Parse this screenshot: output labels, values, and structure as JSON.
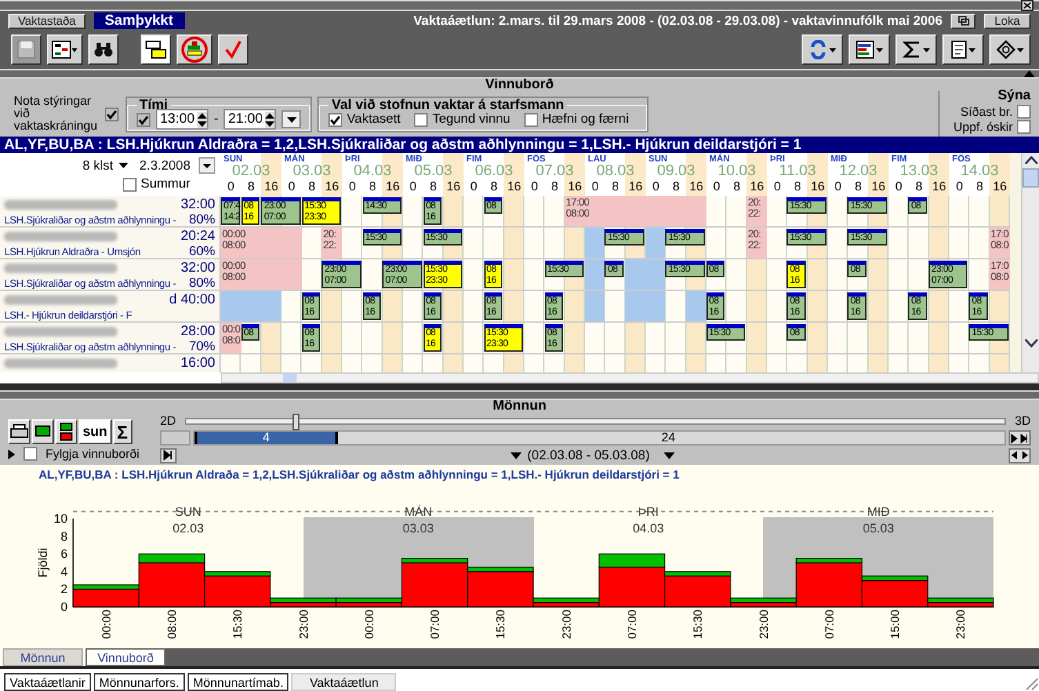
{
  "window": {
    "status_button": "Vaktastaða",
    "status": "Samþykkt",
    "title": "Vaktaáætlun: 2.mars. til 29.mars 2008 - (02.03.08 - 29.03.08) - vaktavinnufólk mai 2006",
    "close_button": "Loka"
  },
  "toolbar": {
    "left": [
      {
        "kind": "save",
        "disabled": true
      },
      {
        "kind": "grid",
        "disabled": false
      },
      {
        "kind": "binoculars",
        "disabled": false
      },
      {
        "kind": "window",
        "disabled": false
      },
      {
        "kind": "circled",
        "disabled": false
      },
      {
        "kind": "check",
        "disabled": false
      }
    ],
    "right": [
      {
        "kind": "refresh"
      },
      {
        "kind": "list"
      },
      {
        "kind": "sum"
      },
      {
        "kind": "document"
      },
      {
        "kind": "gear"
      }
    ]
  },
  "workboard": {
    "title": "Vinnuborð",
    "note_label": "Nota stýringar við vaktaskráningu",
    "note_checked": true,
    "time": {
      "legend": "Tími",
      "checked": true,
      "from": "13:00",
      "separator": "-",
      "to": "21:00"
    },
    "creation": {
      "legend": "Val við stofnun vaktar á starfsmann",
      "options": [
        {
          "label": "Vaktasett",
          "checked": true
        },
        {
          "label": "Tegund vinnu",
          "checked": false
        },
        {
          "label": "Hæfni og færni",
          "checked": false
        }
      ]
    },
    "show": {
      "title": "Sýna",
      "options": [
        {
          "label": "Síðast br.",
          "checked": false
        },
        {
          "label": "Uppf. óskir",
          "checked": false
        }
      ]
    }
  },
  "summary": "AL,YF,BU,BA : LSH.Hjúkrun Aldraðra = 1,2,LSH.Sjúkraliðar og aðstm aðhlynningu = 1,LSH.- Hjúkrun deildarstjóri = 1",
  "schedule": {
    "interval": "8 klst",
    "date": "2.3.2008",
    "sum_label": "Summur",
    "sum_checked": false,
    "days": [
      {
        "weekday": "SUN",
        "date": "02.03",
        "hours": [
          "0",
          "8",
          "16"
        ]
      },
      {
        "weekday": "MÁN",
        "date": "03.03",
        "hours": [
          "0",
          "8",
          "16"
        ]
      },
      {
        "weekday": "ÞRI",
        "date": "04.03",
        "hours": [
          "0",
          "8",
          "16"
        ]
      },
      {
        "weekday": "MIÐ",
        "date": "05.03",
        "hours": [
          "0",
          "8",
          "16"
        ]
      },
      {
        "weekday": "FIM",
        "date": "06.03",
        "hours": [
          "0",
          "8",
          "16"
        ]
      },
      {
        "weekday": "FÖS",
        "date": "07.03",
        "hours": [
          "0",
          "8",
          "16"
        ]
      },
      {
        "weekday": "LAU",
        "date": "08.03",
        "hours": [
          "0",
          "8",
          "16"
        ]
      },
      {
        "weekday": "SUN",
        "date": "09.03",
        "hours": [
          "0",
          "8",
          "16"
        ]
      },
      {
        "weekday": "MÁN",
        "date": "10.03",
        "hours": [
          "0",
          "8",
          "16"
        ]
      },
      {
        "weekday": "ÞRI",
        "date": "11.03",
        "hours": [
          "0",
          "8",
          "16"
        ]
      },
      {
        "weekday": "MIÐ",
        "date": "12.03",
        "hours": [
          "0",
          "8",
          "16"
        ]
      },
      {
        "weekday": "FIM",
        "date": "13.03",
        "hours": [
          "0",
          "8",
          "16"
        ]
      },
      {
        "weekday": "FÖS",
        "date": "14.03",
        "hours": [
          "0",
          "8",
          "16"
        ]
      }
    ],
    "rows": [
      {
        "hours": "32:00",
        "department": "LSH.Sjúkraliðar og aðstm aðhlynningu -",
        "percent": "80%",
        "days": {
          "1": {
            "start": {
              "kind": "day",
              "lines": [
                "07:4",
                "14:2"
              ]
            },
            "middle": {
              "kind": "day-yellow",
              "lines": [
                "08",
                "16"
              ]
            },
            "end": {
              "kind": "night",
              "lines": [
                "23:00",
                "07:00"
              ]
            }
          },
          "2": {
            "middle": {
              "kind": "evening",
              "lines": [
                "15:30",
                "23:30"
              ]
            }
          },
          "3": {
            "middle": {
              "kind": "short",
              "lines": [
                "14:30"
              ]
            }
          },
          "4": {
            "middle": {
              "kind": "day",
              "lines": [
                "08",
                "16"
              ]
            }
          },
          "5": {
            "middle": {
              "kind": "small",
              "lines": [
                "08"
              ]
            }
          },
          "6": {
            "end": {
              "kind": "leave-long",
              "lines": [
                "17:00",
                "08:00"
              ]
            }
          },
          "9": {
            "end": {
              "kind": "leave",
              "lines": [
                "20:",
                "22:"
              ]
            }
          },
          "10": {
            "middle": {
              "kind": "short",
              "lines": [
                "15:30"
              ]
            }
          },
          "11": {
            "middle": {
              "kind": "short",
              "lines": [
                "15:30"
              ]
            }
          },
          "12": {
            "middle": {
              "kind": "small",
              "lines": [
                "08"
              ]
            }
          }
        }
      },
      {
        "hours": "20:24",
        "department": "LSH.Hjúkrun Aldraðra - Umsjón",
        "percent": "60%",
        "days": {
          "1": {
            "start": {
              "kind": "leave-medium",
              "lines": [
                "00:00",
                "08:00"
              ]
            }
          },
          "2": {
            "end": {
              "kind": "leave",
              "lines": [
                "20:",
                "22:"
              ]
            }
          },
          "3": {
            "middle": {
              "kind": "short",
              "lines": [
                "15:30"
              ]
            }
          },
          "4": {
            "middle": {
              "kind": "short",
              "lines": [
                "15:30"
              ]
            }
          },
          "7": {
            "start": {
              "kind": "off"
            },
            "middle": {
              "kind": "short",
              "lines": [
                "15:30"
              ]
            }
          },
          "8": {
            "start": {
              "kind": "off"
            },
            "middle": {
              "kind": "short",
              "lines": [
                "15:30"
              ]
            }
          },
          "9": {
            "end": {
              "kind": "leave",
              "lines": [
                "20:",
                "22:"
              ]
            }
          },
          "10": {
            "middle": {
              "kind": "short",
              "lines": [
                "15:30"
              ]
            }
          },
          "11": {
            "middle": {
              "kind": "short",
              "lines": [
                "15:30"
              ]
            }
          },
          "13": {
            "end": {
              "kind": "leave",
              "lines": [
                "17:0",
                "08:0"
              ]
            }
          }
        }
      },
      {
        "hours": "32:00",
        "department": "LSH.Sjúkraliðar og aðstm aðhlynningu -",
        "percent": "80%",
        "days": {
          "1": {
            "start": {
              "kind": "leave-medium",
              "lines": [
                "00:00",
                "08:00"
              ]
            }
          },
          "2": {
            "end": {
              "kind": "night",
              "lines": [
                "23:00",
                "07:00"
              ]
            }
          },
          "3": {
            "end": {
              "kind": "night",
              "lines": [
                "23:00",
                "07:00"
              ]
            }
          },
          "4": {
            "middle": {
              "kind": "evening",
              "lines": [
                "15:30",
                "23:30"
              ]
            }
          },
          "5": {
            "middle": {
              "kind": "day-yellow",
              "lines": [
                "08",
                "16"
              ]
            }
          },
          "6": {
            "middle": {
              "kind": "short",
              "lines": [
                "15:30"
              ]
            }
          },
          "7": {
            "start": {
              "kind": "off"
            },
            "middle": {
              "kind": "small",
              "lines": [
                "08"
              ]
            },
            "end": {
              "kind": "off"
            }
          },
          "8": {
            "start": {
              "kind": "off"
            },
            "middle": {
              "kind": "short",
              "lines": [
                "15:30"
              ]
            }
          },
          "9": {
            "start": {
              "kind": "small",
              "lines": [
                "08"
              ]
            }
          },
          "10": {
            "middle": {
              "kind": "day-yellow",
              "lines": [
                "08",
                "16"
              ]
            }
          },
          "11": {
            "middle": {
              "kind": "small",
              "lines": [
                "08"
              ]
            }
          },
          "12": {
            "end": {
              "kind": "night",
              "lines": [
                "23:00",
                "07:00"
              ]
            }
          },
          "13": {
            "end": {
              "kind": "leave",
              "lines": [
                "17:0",
                "08:0"
              ]
            }
          }
        }
      },
      {
        "hours": "d 40:00",
        "department": "LSH.- Hjúkrun deildarstjóri - F",
        "days": {
          "1": {
            "start": {
              "kind": "off"
            },
            "middle": {
              "kind": "off"
            },
            "end": {
              "kind": "off"
            }
          },
          "2": {
            "middle": {
              "kind": "day",
              "lines": [
                "08",
                "16"
              ]
            }
          },
          "3": {
            "middle": {
              "kind": "day",
              "lines": [
                "08",
                "16"
              ]
            }
          },
          "4": {
            "middle": {
              "kind": "day",
              "lines": [
                "08",
                "16"
              ]
            }
          },
          "5": {
            "middle": {
              "kind": "day",
              "lines": [
                "08",
                "16"
              ]
            }
          },
          "6": {
            "middle": {
              "kind": "day",
              "lines": [
                "08",
                "16"
              ]
            }
          },
          "7": {
            "start": {
              "kind": "off"
            },
            "end": {
              "kind": "off"
            }
          },
          "8": {
            "start": {
              "kind": "off"
            },
            "end": {
              "kind": "off"
            }
          },
          "9": {
            "start": {
              "kind": "day",
              "lines": [
                "08",
                "16"
              ]
            }
          },
          "10": {
            "middle": {
              "kind": "day",
              "lines": [
                "08",
                "16"
              ]
            }
          },
          "11": {
            "middle": {
              "kind": "day",
              "lines": [
                "08",
                "16"
              ]
            }
          },
          "12": {
            "middle": {
              "kind": "day",
              "lines": [
                "08",
                "16"
              ]
            }
          },
          "13": {
            "middle": {
              "kind": "day",
              "lines": [
                "08",
                "16"
              ]
            }
          }
        }
      },
      {
        "hours": "28:00",
        "department": "LSH.Sjúkraliðar og aðstm aðhlynningu -",
        "percent": "70%",
        "days": {
          "1": {
            "start": {
              "kind": "leave",
              "lines": [
                "00:0",
                "08:0"
              ]
            },
            "middle": {
              "kind": "small",
              "lines": [
                "08"
              ]
            }
          },
          "2": {
            "middle": {
              "kind": "day",
              "lines": [
                "08",
                "16"
              ]
            }
          },
          "4": {
            "middle": {
              "kind": "day-yellow",
              "lines": [
                "08",
                "16"
              ]
            }
          },
          "5": {
            "middle": {
              "kind": "evening",
              "lines": [
                "15:30",
                "23:30"
              ]
            }
          },
          "6": {
            "middle": {
              "kind": "day",
              "lines": [
                "08",
                "16"
              ]
            }
          },
          "9": {
            "start": {
              "kind": "short",
              "lines": [
                "15:30"
              ]
            }
          },
          "10": {
            "middle": {
              "kind": "small",
              "lines": [
                "08"
              ]
            }
          },
          "13": {
            "middle": {
              "kind": "short",
              "lines": [
                "15:30"
              ]
            }
          }
        }
      }
    ],
    "partial_row": {
      "hours": "16:00"
    }
  },
  "staffing": {
    "title": "Mönnun",
    "sun_button": "sun",
    "sum_button": "Σ",
    "follow_label": "Fylgja vinnuborði",
    "follow_checked": false,
    "depth": {
      "left": "2D",
      "right": "3D",
      "level": 0.13
    },
    "range": {
      "first": "4",
      "total": "24",
      "level": 0.17
    },
    "period": "(02.03.08 - 05.03.08)",
    "chart_data": {
      "type": "bar",
      "stacked": true,
      "title": "AL,YF,BU,BA : LSH.Hjúkrun Aldraða = 1,2,LSH.Sjúkraliðar og aðstm aðhlynningu = 1,LSH.- Hjúkrun deildarstjóri = 1",
      "ylabel": "Fjöldi",
      "categories": [
        "00:00",
        "08:00",
        "15:30",
        "23:00",
        "00:00",
        "07:00",
        "15:30",
        "23:00",
        "07:00",
        "15:30",
        "23:00",
        "07:00",
        "15:00",
        "23:00"
      ],
      "ylim": [
        0,
        10
      ],
      "yticks": [
        0,
        2,
        4,
        6,
        8,
        10
      ],
      "series": [
        {
          "color": "#ff0000",
          "values": [
            2,
            5,
            3.5,
            0.5,
            0.5,
            5,
            4,
            0.5,
            4.5,
            3.5,
            0.5,
            5,
            3,
            0.5
          ]
        },
        {
          "color": "#00c000",
          "values": [
            0.5,
            1,
            0.5,
            0.5,
            0.5,
            0.5,
            0.5,
            0.5,
            1.5,
            0.5,
            0.5,
            0.5,
            0.5,
            0.5
          ]
        }
      ],
      "annotations": [
        {
          "text": "SUN"
        },
        {
          "text": "02.03"
        },
        {
          "text": "MÁN"
        },
        {
          "text": "03.03"
        },
        {
          "text": "ÞRI"
        },
        {
          "text": "04.03"
        },
        {
          "text": "MIÐ"
        },
        {
          "text": "05.03"
        }
      ]
    },
    "tabs": [
      {
        "label": "Mönnun",
        "selected": false
      },
      {
        "label": "Vinnuborð",
        "selected": true
      }
    ]
  },
  "bottom_tabs": [
    {
      "label": "Vaktaáætlanir",
      "selected": false
    },
    {
      "label": "Mönnunarfors.",
      "selected": false
    },
    {
      "label": "Mönnunartímab.",
      "selected": false
    },
    {
      "label": "Vaktaáætlun",
      "selected": true
    }
  ]
}
